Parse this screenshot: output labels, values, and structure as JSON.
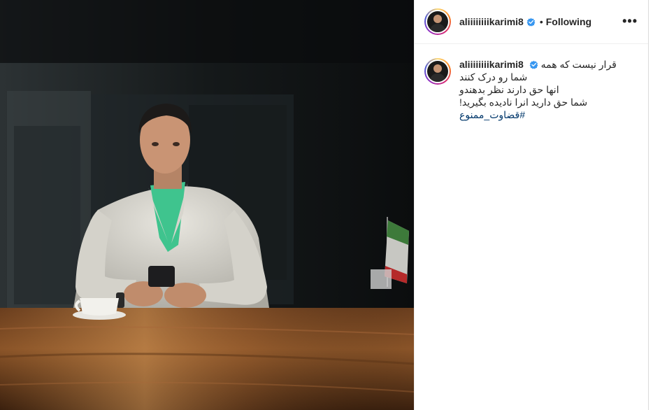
{
  "post": {
    "username": "aliiiiiiiikarimi8",
    "follow_status": "Following",
    "more_options": "•••",
    "caption": {
      "line1": "قرار نیست که همه",
      "line2": "شما رو درک کنند",
      "line3": "انها حق دارند نظر بدهندو",
      "line4": "شما حق دارید انرا نادیده بگیرید!",
      "hashtag": "#قضاوت_ممنوع"
    }
  },
  "colors": {
    "verified_badge": "#3897f0",
    "hashtag": "#00376b",
    "text": "#262626"
  },
  "icons": {
    "verified": "verified-badge-icon",
    "more": "more-options-icon"
  }
}
